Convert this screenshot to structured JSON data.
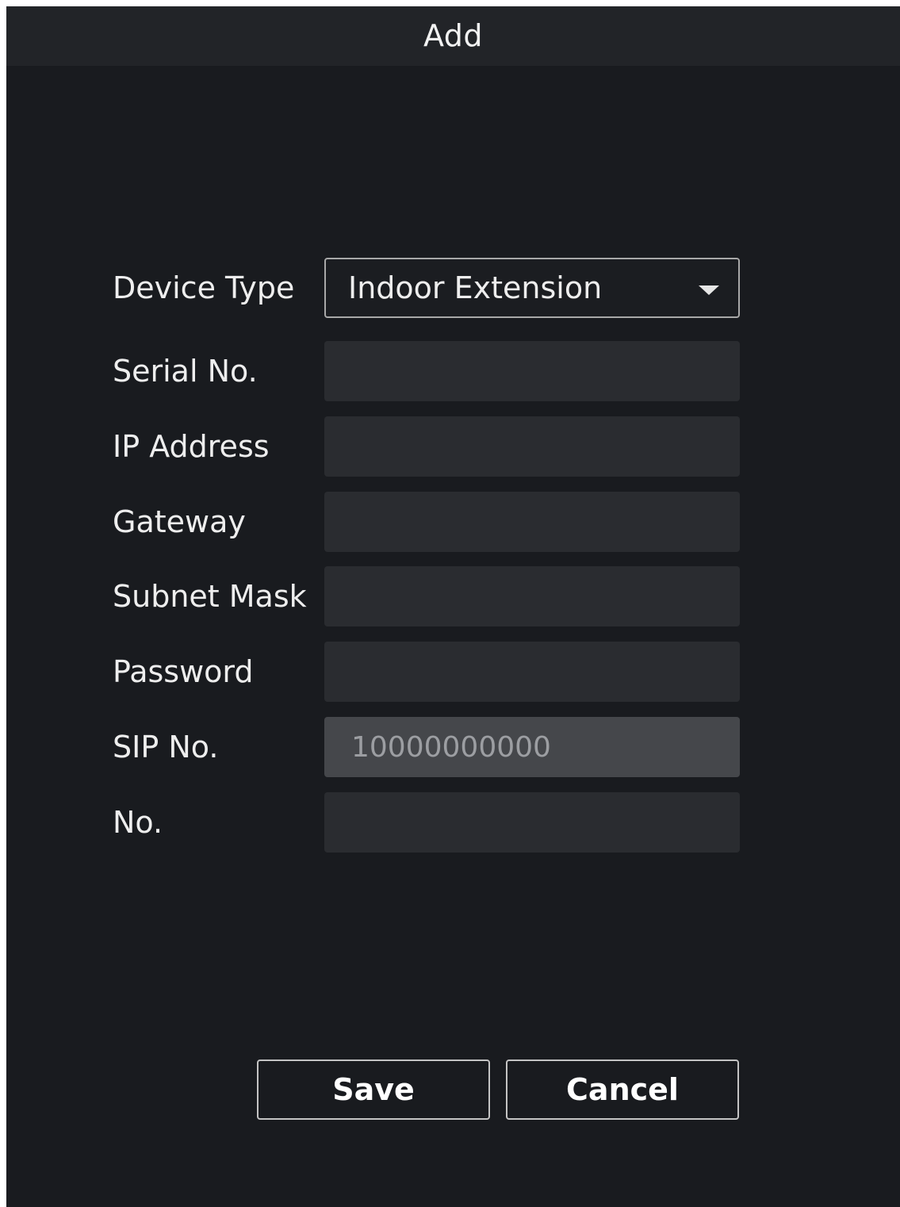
{
  "dialog": {
    "title": "Add"
  },
  "form": {
    "device_type": {
      "label": "Device Type",
      "value": "Indoor Extension"
    },
    "serial_no": {
      "label": "Serial No.",
      "value": ""
    },
    "ip_address": {
      "label": "IP Address",
      "value": ""
    },
    "gateway": {
      "label": "Gateway",
      "value": ""
    },
    "subnet_mask": {
      "label": "Subnet Mask",
      "value": ""
    },
    "password": {
      "label": "Password",
      "value": ""
    },
    "sip_no": {
      "label": "SIP No.",
      "value": "10000000000"
    },
    "no": {
      "label": "No.",
      "value": ""
    }
  },
  "buttons": {
    "save_label": "Save",
    "cancel_label": "Cancel"
  },
  "colors": {
    "background": "#191b1f",
    "title_bar": "#222428",
    "field": "#2a2c30",
    "field_disabled": "#45474b"
  },
  "icons": {
    "dropdown": "caret-down-icon"
  }
}
